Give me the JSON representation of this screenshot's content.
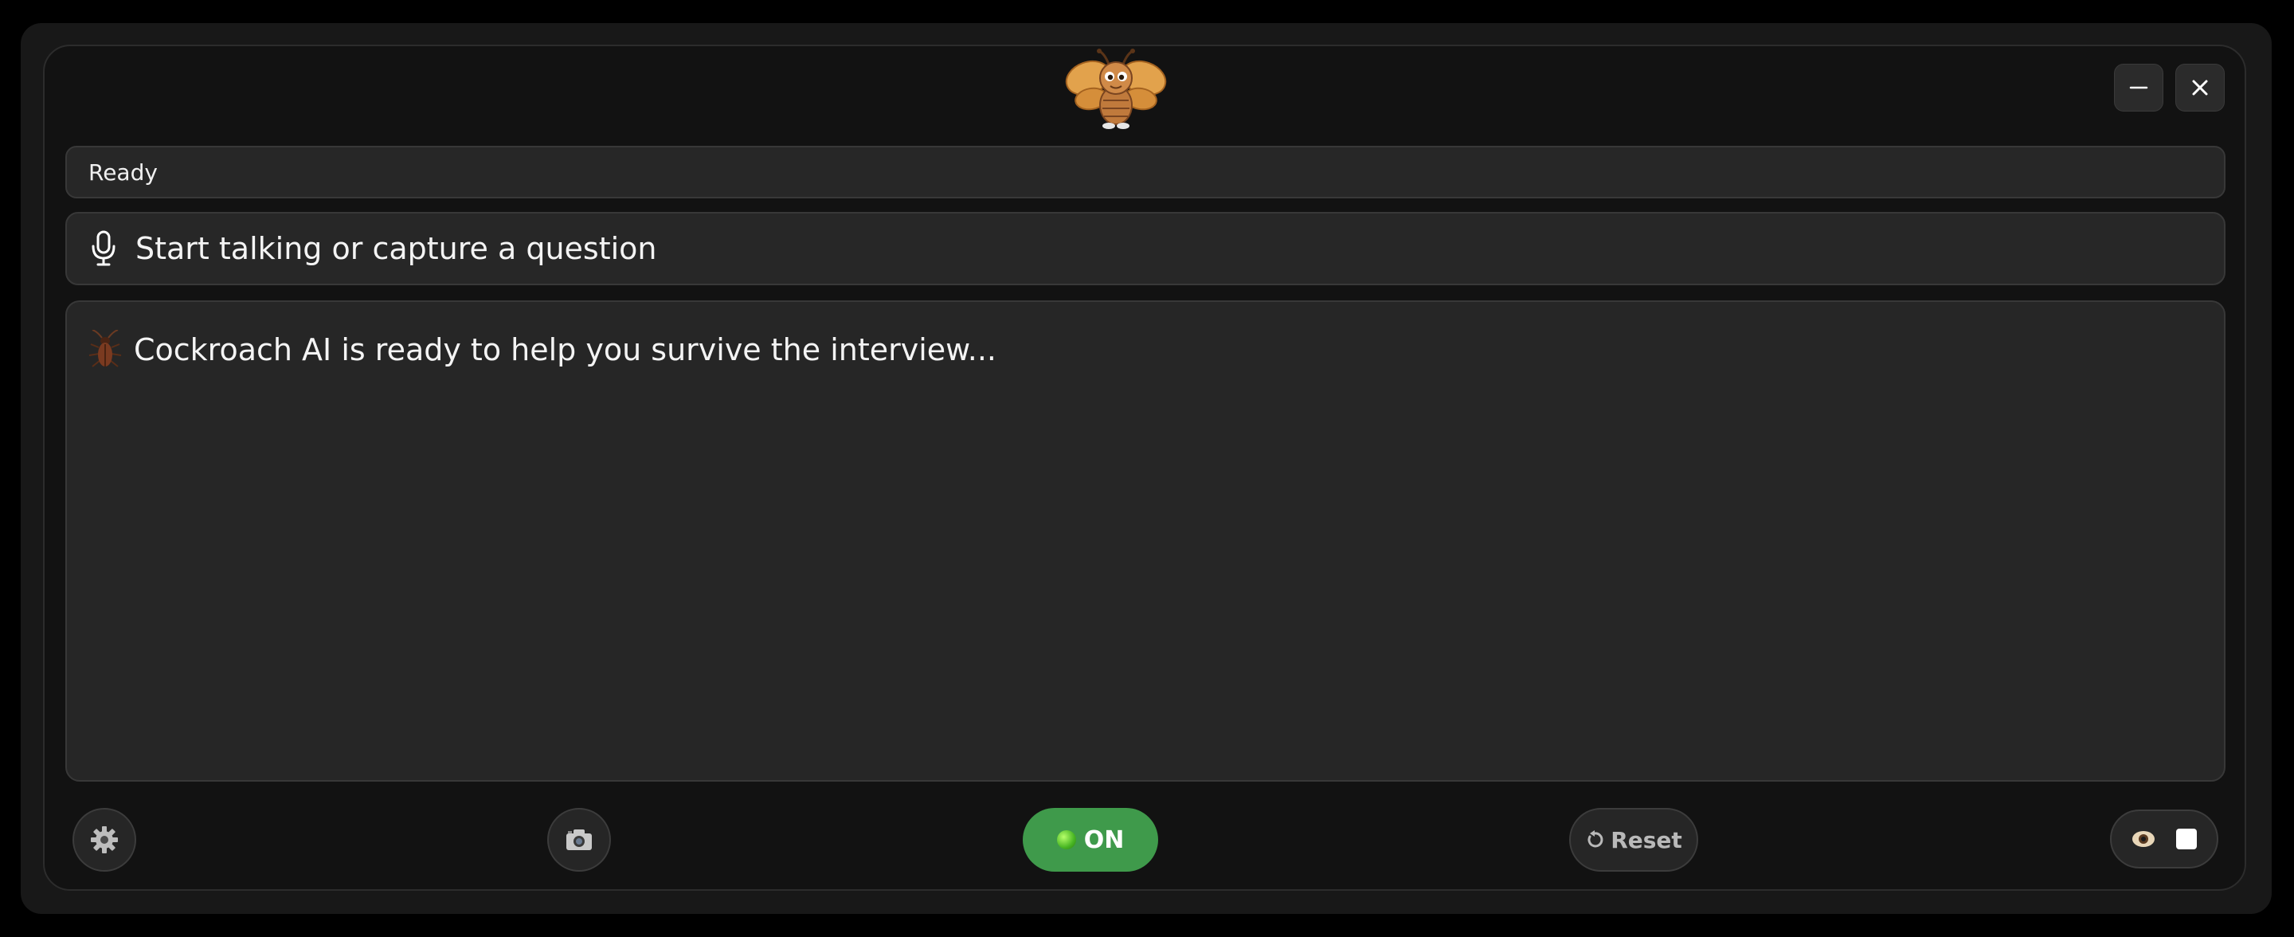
{
  "window": {
    "minimize_label": "—",
    "close_label": "✕"
  },
  "status": {
    "text": "Ready"
  },
  "prompt": {
    "text": "Start talking or capture a question",
    "icon": "microphone-icon"
  },
  "response": {
    "text": "Cockroach AI is ready to help you survive the interview...",
    "icon": "cockroach-icon"
  },
  "toolbar": {
    "settings_icon": "gear-icon",
    "camera_icon": "camera-icon",
    "toggle_label": "ON",
    "reset_label": "Reset",
    "visibility_icon": "eye-icon",
    "checkbox_checked": false
  },
  "colors": {
    "toggle_on": "#3f9a4b",
    "background": "#121212",
    "panel": "#262626"
  }
}
